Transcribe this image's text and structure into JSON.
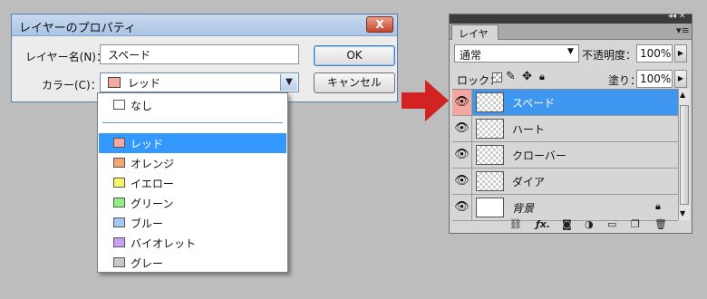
{
  "dialog": {
    "title": "レイヤーのプロパティ",
    "close_label": "X",
    "name_label": "レイヤー名(N)：",
    "name_value": "スペード",
    "color_label": "カラー(C)：",
    "color_value": "レッド",
    "color_swatch": "#f4a9a0",
    "ok_label": "OK",
    "cancel_label": "キャンセル"
  },
  "dropdown": {
    "options": [
      {
        "label": "なし",
        "color": "#ffffff"
      },
      {
        "label": "レッド",
        "color": "#f4a9a0",
        "selected": true
      },
      {
        "label": "オレンジ",
        "color": "#f7a571"
      },
      {
        "label": "イエロー",
        "color": "#fbf46b"
      },
      {
        "label": "グリーン",
        "color": "#93ee86"
      },
      {
        "label": "ブルー",
        "color": "#a4c8f4"
      },
      {
        "label": "バイオレット",
        "color": "#c9a0f2"
      },
      {
        "label": "グレー",
        "color": "#c8c8c4"
      }
    ]
  },
  "layers_panel": {
    "tab_label": "レイヤー",
    "blend_mode": "通常",
    "opacity_label": "不透明度：",
    "opacity_value": "100%",
    "lock_label": "ロック：",
    "fill_label": "塗り：",
    "fill_value": "100%",
    "layers": [
      {
        "name": "スペード",
        "active": true,
        "color_tag": "#f3a7a0"
      },
      {
        "name": "ハート"
      },
      {
        "name": "クローバー"
      },
      {
        "name": "ダイア"
      },
      {
        "name": "背景",
        "locked": true
      }
    ]
  },
  "colors": {
    "accent_blue": "#3e96ef",
    "arrow_red": "#d32222"
  }
}
